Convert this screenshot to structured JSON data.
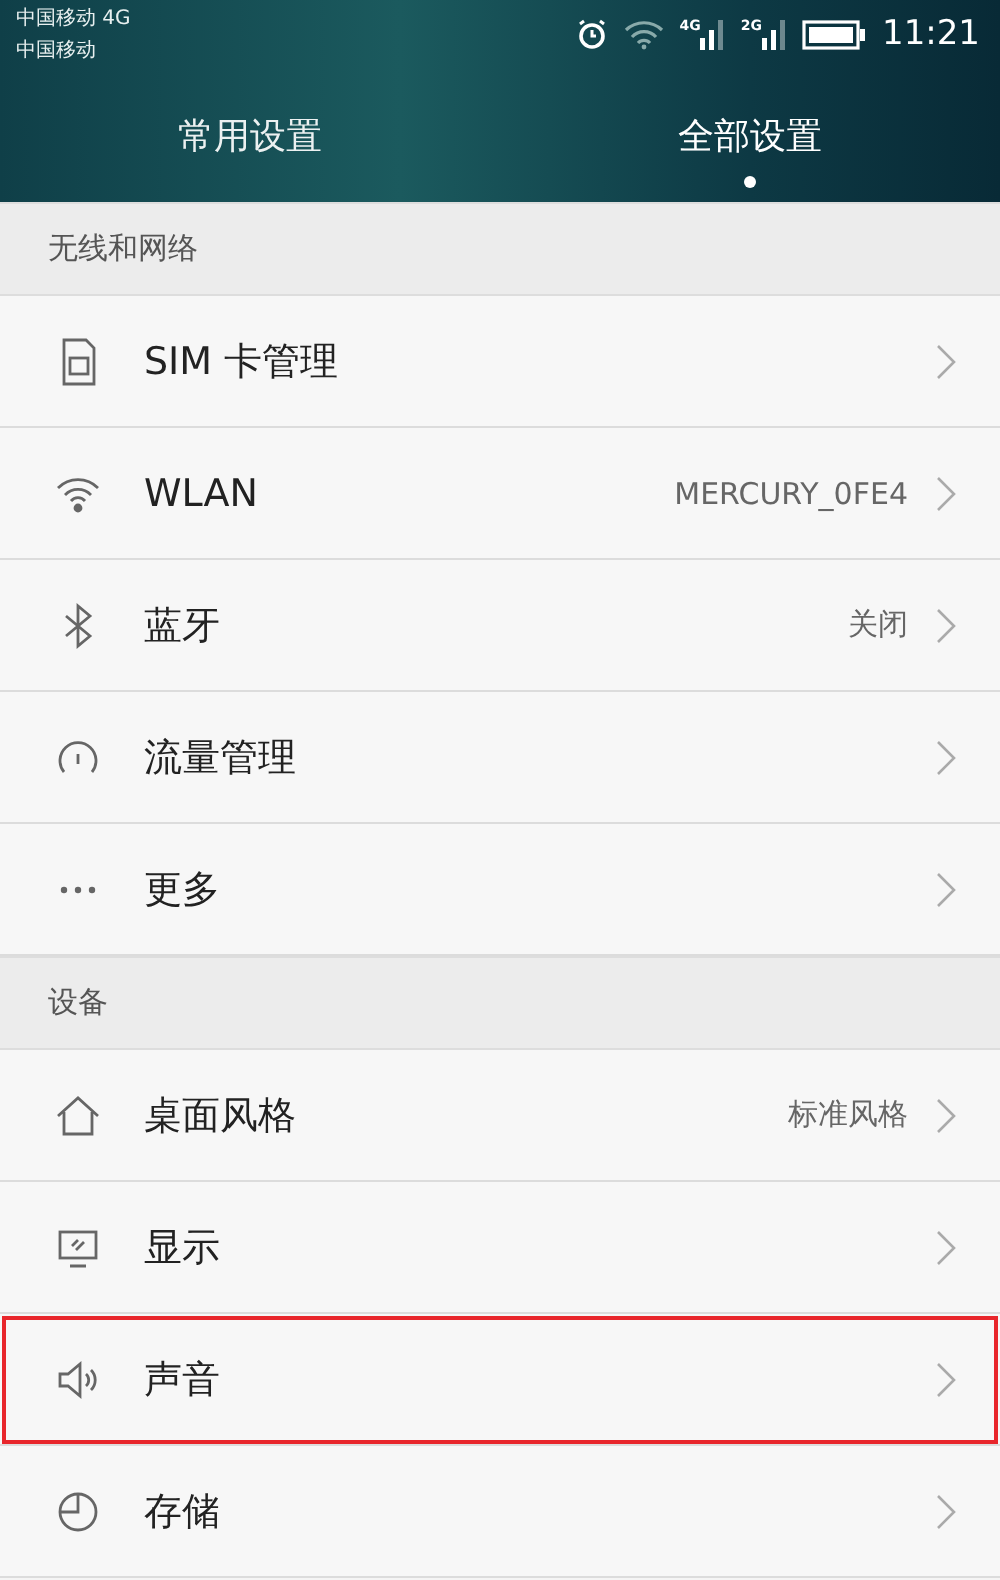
{
  "status_bar": {
    "carriers": [
      "中国移动 4G",
      "中国移动"
    ],
    "network_labels": [
      "4G",
      "2G"
    ],
    "time": "11:21"
  },
  "tabs": [
    {
      "label": "常用设置",
      "selected": false
    },
    {
      "label": "全部设置",
      "selected": true
    }
  ],
  "sections": [
    {
      "title": "无线和网络",
      "items": [
        {
          "kind": "sim",
          "label": "SIM 卡管理",
          "highlighted": false
        },
        {
          "kind": "wifi",
          "label": "WLAN",
          "value": "MERCURY_0FE4",
          "highlighted": false
        },
        {
          "kind": "bluetooth",
          "label": "蓝牙",
          "value": "关闭",
          "highlighted": false
        },
        {
          "kind": "gauge",
          "label": "流量管理",
          "highlighted": false
        },
        {
          "kind": "more",
          "label": "更多",
          "highlighted": false
        }
      ]
    },
    {
      "title": "设备",
      "items": [
        {
          "kind": "home",
          "label": "桌面风格",
          "value": "标准风格",
          "highlighted": false
        },
        {
          "kind": "display",
          "label": "显示",
          "highlighted": false
        },
        {
          "kind": "speaker",
          "label": "声音",
          "highlighted": true
        },
        {
          "kind": "storage",
          "label": "存储",
          "highlighted": false
        }
      ]
    }
  ]
}
